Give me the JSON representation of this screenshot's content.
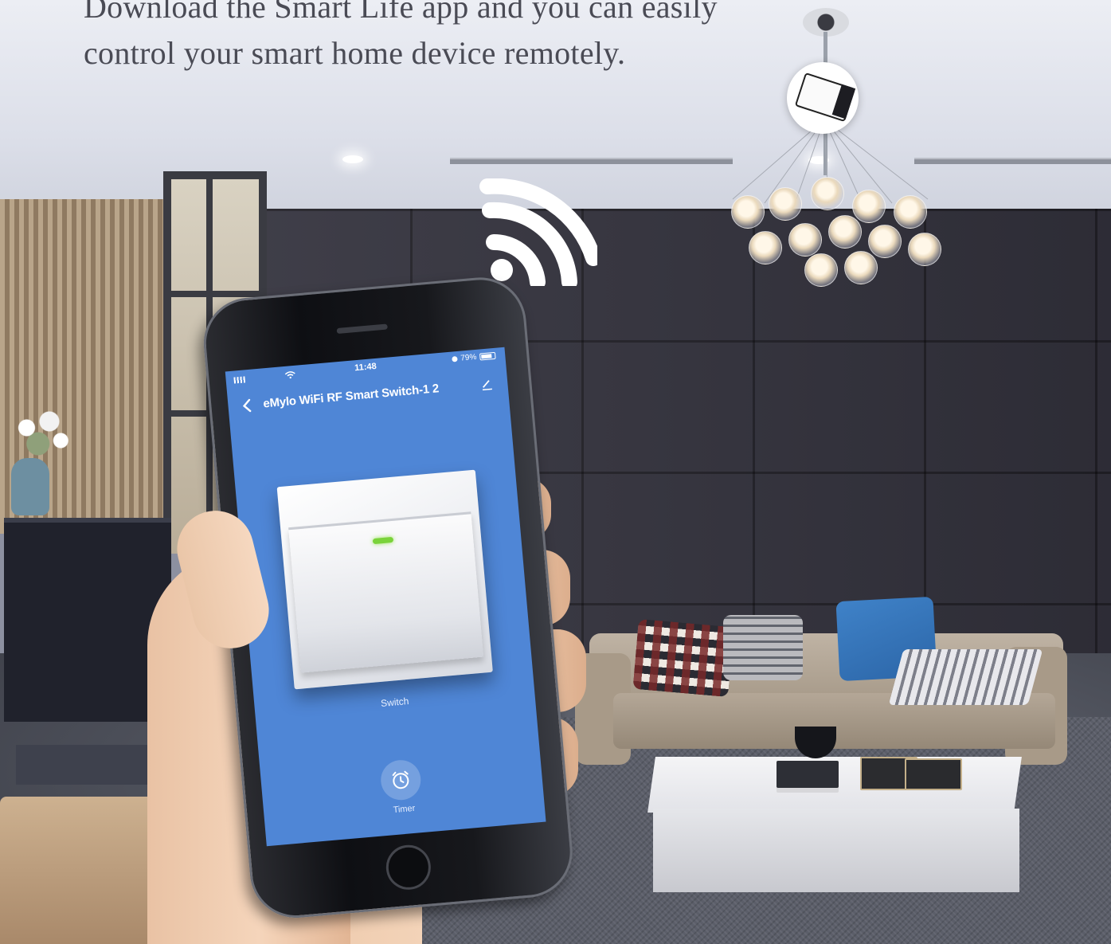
{
  "headline": {
    "line1": "Download the Smart Life app and you can easily",
    "line2": "control your smart home device remotely."
  },
  "phone": {
    "status_bar": {
      "time": "11:48",
      "battery_percent_text": "79%",
      "battery_level": 0.79
    },
    "app": {
      "title": "eMylo WiFi RF Smart Switch-1 2",
      "switch_label": "Switch",
      "timer_label": "Timer"
    }
  },
  "icons": {
    "wifi": "wifi-icon",
    "back": "chevron-left-icon",
    "edit": "pencil-icon",
    "timer": "alarm-clock-icon",
    "device": "smart-switch-module-icon"
  },
  "colors": {
    "app_background": "#4f86d6",
    "switch_led": "#7ad33a",
    "headline_text": "#4a4b55"
  }
}
